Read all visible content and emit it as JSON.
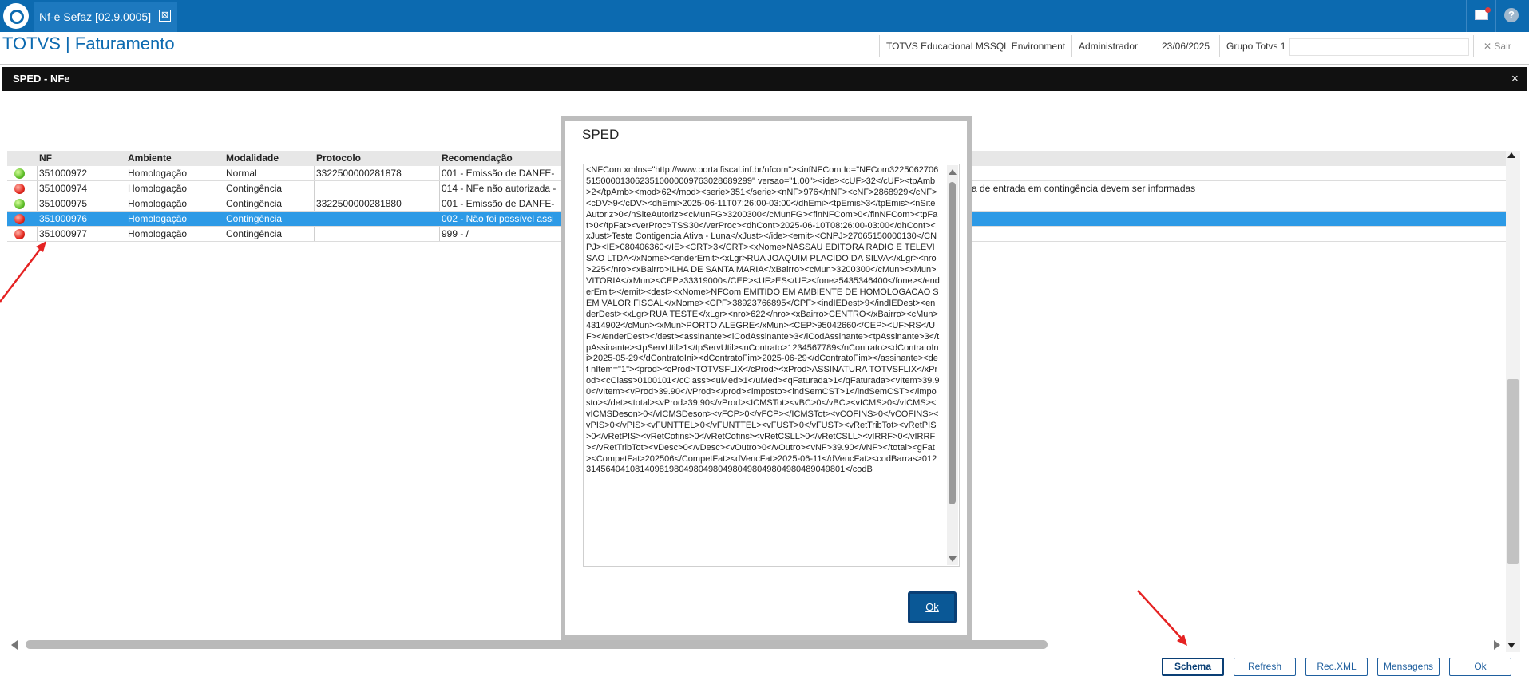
{
  "topbar": {
    "tab_title": "Nf-e Sefaz [02.9.0005]",
    "tab_close": "⊠",
    "help": "?"
  },
  "app": {
    "title": "TOTVS | Faturamento"
  },
  "header": {
    "environment": "TOTVS Educacional MSSQL Environment",
    "user": "Administrador",
    "date": "23/06/2025",
    "group": "Grupo Totvs 1",
    "exit": "✕ Sair"
  },
  "panel": {
    "title": "SPED - NFe",
    "close": "×"
  },
  "grid": {
    "columns": [
      "NF",
      "Ambiente",
      "Modalidade",
      "Protocolo",
      "Recomendação"
    ],
    "rows": [
      {
        "status": "green",
        "nf": "351000972",
        "ambiente": "Homologação",
        "modalidade": "Normal",
        "protocolo": "3322500000281878",
        "recomendacao": "001 - Emissão de DANFE-"
      },
      {
        "status": "red",
        "nf": "351000974",
        "ambiente": "Homologação",
        "modalidade": "Contingência",
        "protocolo": "",
        "recomendacao": "014 - NFe não autorizada -",
        "extra": "a de entrada em contingência devem ser informadas"
      },
      {
        "status": "green",
        "nf": "351000975",
        "ambiente": "Homologação",
        "modalidade": "Contingência",
        "protocolo": "3322500000281880",
        "recomendacao": "001 - Emissão de DANFE-"
      },
      {
        "status": "red",
        "nf": "351000976",
        "ambiente": "Homologação",
        "modalidade": "Contingência",
        "protocolo": "",
        "recomendacao": "002 - Não foi possível assi"
      },
      {
        "status": "red",
        "nf": "351000977",
        "ambiente": "Homologação",
        "modalidade": "Contingência",
        "protocolo": "",
        "recomendacao": "999 - /"
      }
    ]
  },
  "buttons": {
    "schema": "Schema",
    "refresh": "Refresh",
    "rec_xml": "Rec.XML",
    "mensagens": "Mensagens",
    "ok": "Ok"
  },
  "modal": {
    "title": "SPED",
    "xml": "<NFCom xmlns=\"http://www.portalfiscal.inf.br/nfcom\"><infNFCom Id=\"NFCom32250627065150000130623510000009763028689299\" versao=\"1.00\"><ide><cUF>32</cUF><tpAmb>2</tpAmb><mod>62</mod><serie>351</serie><nNF>976</nNF><cNF>2868929</cNF><cDV>9</cDV><dhEmi>2025-06-11T07:26:00-03:00</dhEmi><tpEmis>3</tpEmis><nSiteAutoriz>0</nSiteAutoriz><cMunFG>3200300</cMunFG><finNFCom>0</finNFCom><tpFat>0</tpFat><verProc>TSS30</verProc><dhCont>2025-06-10T08:26:00-03:00</dhCont><xJust>Teste Contigencia Ativa - Luna</xJust></ide><emit><CNPJ>27065150000130</CNPJ><IE>080406360</IE><CRT>3</CRT><xNome>NASSAU EDITORA RADIO E TELEVISAO LTDA</xNome><enderEmit><xLgr>RUA JOAQUIM PLACIDO DA SILVA</xLgr><nro>225</nro><xBairro>ILHA DE SANTA MARIA</xBairro><cMun>3200300</cMun><xMun>VITORIA</xMun><CEP>33319000</CEP><UF>ES</UF><fone>5435346400</fone></enderEmit></emit><dest><xNome>NFCom EMITIDO EM AMBIENTE DE HOMOLOGACAO SEM VALOR FISCAL</xNome><CPF>38923766895</CPF><indIEDest>9</indIEDest><enderDest><xLgr>RUA TESTE</xLgr><nro>622</nro><xBairro>CENTRO</xBairro><cMun>4314902</cMun><xMun>PORTO ALEGRE</xMun><CEP>95042660</CEP><UF>RS</UF></enderDest></dest><assinante><iCodAssinante>3</iCodAssinante><tpAssinante>3</tpAssinante><tpServUtil>1</tpServUtil><nContrato>1234567789</nContrato><dContratoIni>2025-05-29</dContratoIni><dContratoFim>2025-06-29</dContratoFim></assinante><det nItem=\"1\"><prod><cProd>TOTVSFLIX</cProd><xProd>ASSINATURA TOTVSFLIX</xProd><cClass>0100101</cClass><uMed>1</uMed><qFaturada>1</qFaturada><vItem>39.90</vItem><vProd>39.90</vProd></prod><imposto><indSemCST>1</indSemCST></imposto></det><total><vProd>39.90</vProd><ICMSTot><vBC>0</vBC><vICMS>0</vICMS><vICMSDeson>0</vICMSDeson><vFCP>0</vFCP></ICMSTot><vCOFINS>0</vCOFINS><vPIS>0</vPIS><vFUNTTEL>0</vFUNTTEL><vFUST>0</vFUST><vRetTribTot><vRetPIS>0</vRetPIS><vRetCofins>0</vRetCofins><vRetCSLL>0</vRetCSLL><vIRRF>0</vIRRF></vRetTribTot><vDesc>0</vDesc><vOutro>0</vOutro><vNF>39.90</vNF></total><gFat><CompetFat>202506</CompetFat><dVencFat>2025-06-11</dVencFat><codBarras>01231456404108140981980498049804980498049804980489049801</codB",
    "ok_label": "Ok"
  },
  "colors": {
    "topbar": "#0c6ab0",
    "selected_row": "#2d9ae6",
    "annotation_arrow": "#e52222",
    "modal_ok": "#0a5896"
  }
}
